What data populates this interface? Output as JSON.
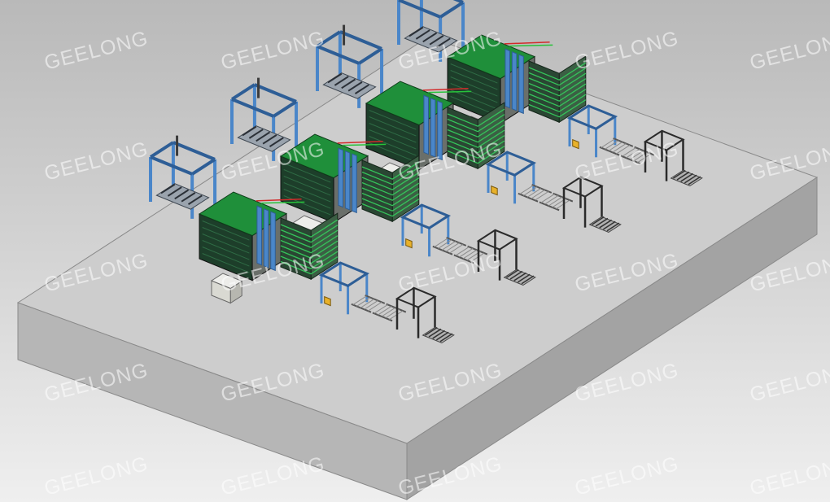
{
  "watermark": {
    "text": "GEELONG"
  },
  "scene": {
    "description_label": "",
    "production_lines": 4
  },
  "colors": {
    "background": "#c8c8c8",
    "platform_top": "#cfcfcf",
    "platform_front": "#b4b4b4",
    "platform_side": "#9e9e9e",
    "frame_blue": "#4a86c9",
    "frame_dark_blue": "#2e5e96",
    "belt_green": "#1f8f3a",
    "dark_green": "#1d3e2a",
    "panel_gray": "#6a6f6a",
    "rail_black": "#2a2a2a",
    "accent_yellow": "#e8b12a",
    "accent_red": "#d22a2a"
  }
}
